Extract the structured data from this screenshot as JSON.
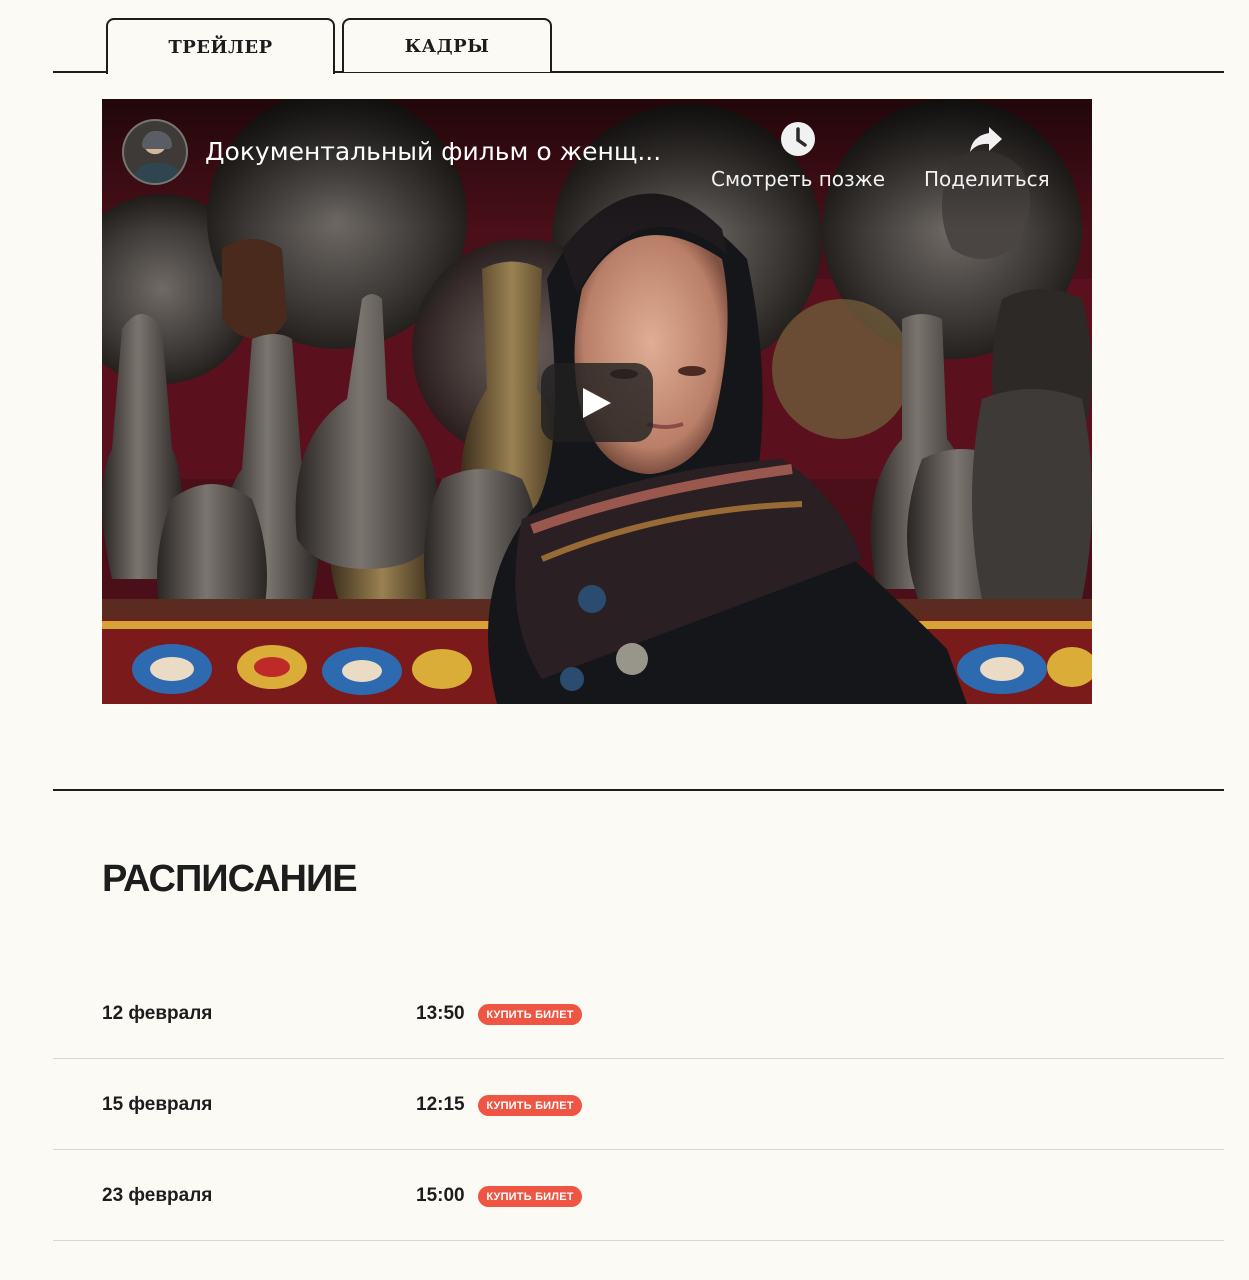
{
  "tabs": [
    {
      "label": "ТРЕЙЛЕР",
      "active": true
    },
    {
      "label": "КАДРЫ",
      "active": false
    }
  ],
  "video": {
    "title": "Документальный фильм о женщ...",
    "watch_later_label": "Смотреть позже",
    "share_label": "Поделиться",
    "icons": {
      "watch_later": "clock-icon",
      "share": "share-arrow-icon",
      "play": "play-icon"
    }
  },
  "schedule": {
    "title": "РАСПИСАНИЕ",
    "rows": [
      {
        "date": "12 февраля",
        "time": "13:50",
        "button": "КУПИТЬ БИЛЕТ"
      },
      {
        "date": "15 февраля",
        "time": "12:15",
        "button": "КУПИТЬ БИЛЕТ"
      },
      {
        "date": "23 февраля",
        "time": "15:00",
        "button": "КУПИТЬ БИЛЕТ"
      }
    ]
  },
  "colors": {
    "background": "#fbfaf5",
    "text": "#1d1d1d",
    "buy_button": "#ee5643"
  }
}
